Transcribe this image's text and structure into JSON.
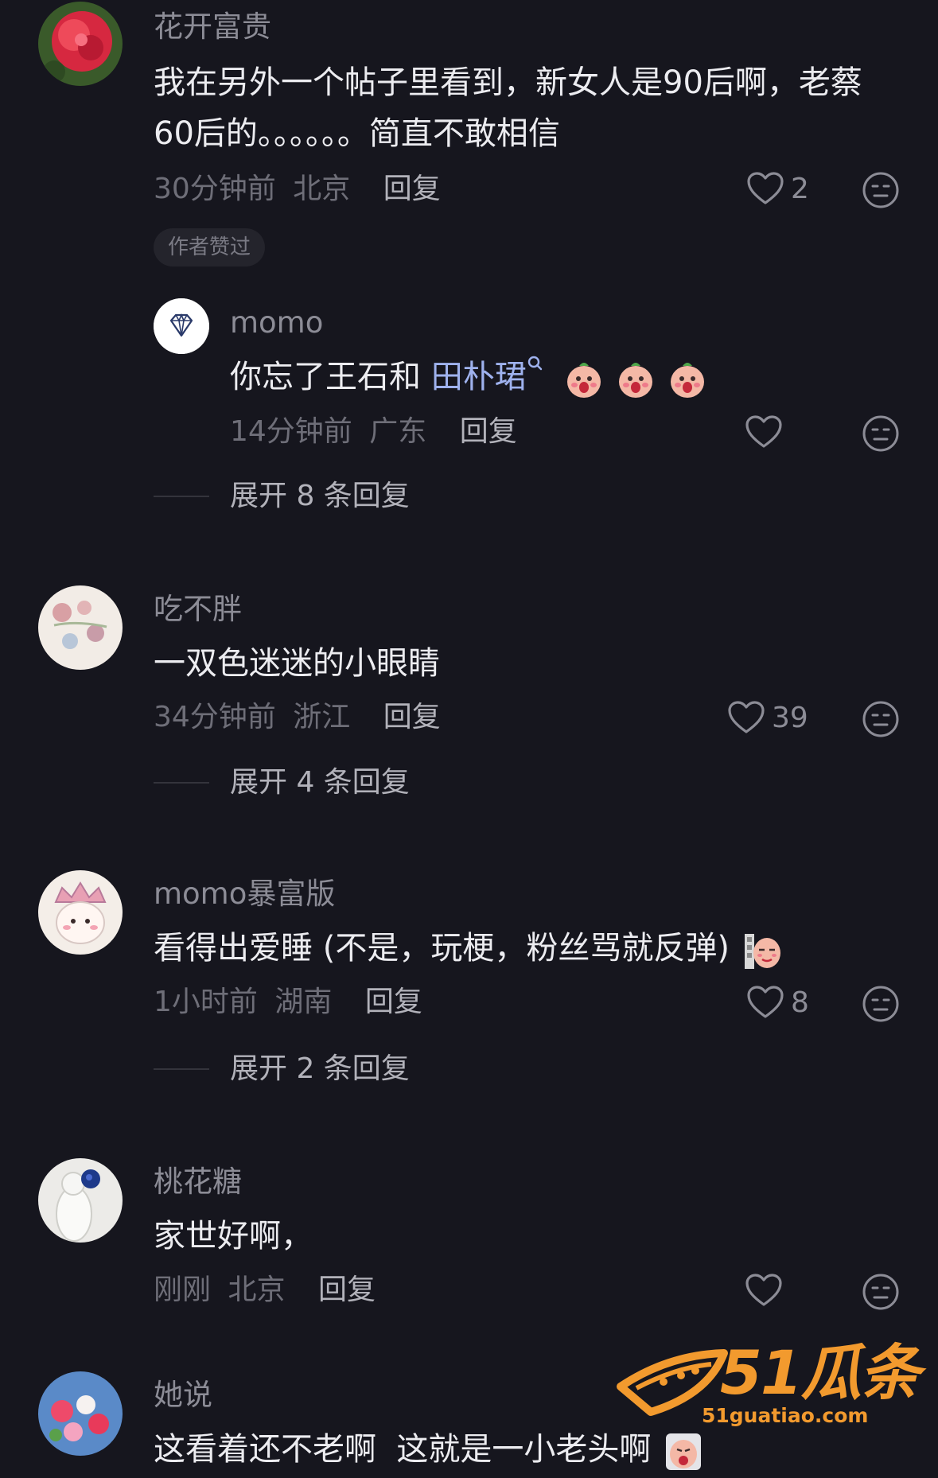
{
  "comments": [
    {
      "username": "花开富贵",
      "text_line1": "我在另外一个帖子里看到，新女人是90后啊，老蔡",
      "text_line2": "60后的。。。。。。简直不敢相信",
      "time": "30分钟前",
      "location": "北京",
      "reply_label": "回复",
      "likes": "2",
      "badge": "作者赞过",
      "sub_reply": {
        "username": "momo",
        "text_prefix": "你忘了王石和 ",
        "mention": "田朴珺",
        "mention_icon": "search-icon",
        "time": "14分钟前",
        "location": "广东",
        "reply_label": "回复"
      },
      "expand_label": "展开 8 条回复"
    },
    {
      "username": "吃不胖",
      "text": "一双色迷迷的小眼睛",
      "time": "34分钟前",
      "location": "浙江",
      "reply_label": "回复",
      "likes": "39",
      "expand_label": "展开 4 条回复"
    },
    {
      "username": "momo暴富版",
      "text": "看得出爱睡 (不是，玩梗，粉丝骂就反弹)",
      "time": "1小时前",
      "location": "湖南",
      "reply_label": "回复",
      "likes": "8",
      "expand_label": "展开 2 条回复"
    },
    {
      "username": "桃花糖",
      "text": "家世好啊，",
      "time": "刚刚",
      "location": "北京",
      "reply_label": "回复"
    },
    {
      "username": "她说",
      "text": "这看着还不老啊  这就是一小老头啊"
    }
  ],
  "watermark": {
    "main": "51瓜条",
    "sub": "51guatiao.com",
    "color": "#f29a2e"
  }
}
